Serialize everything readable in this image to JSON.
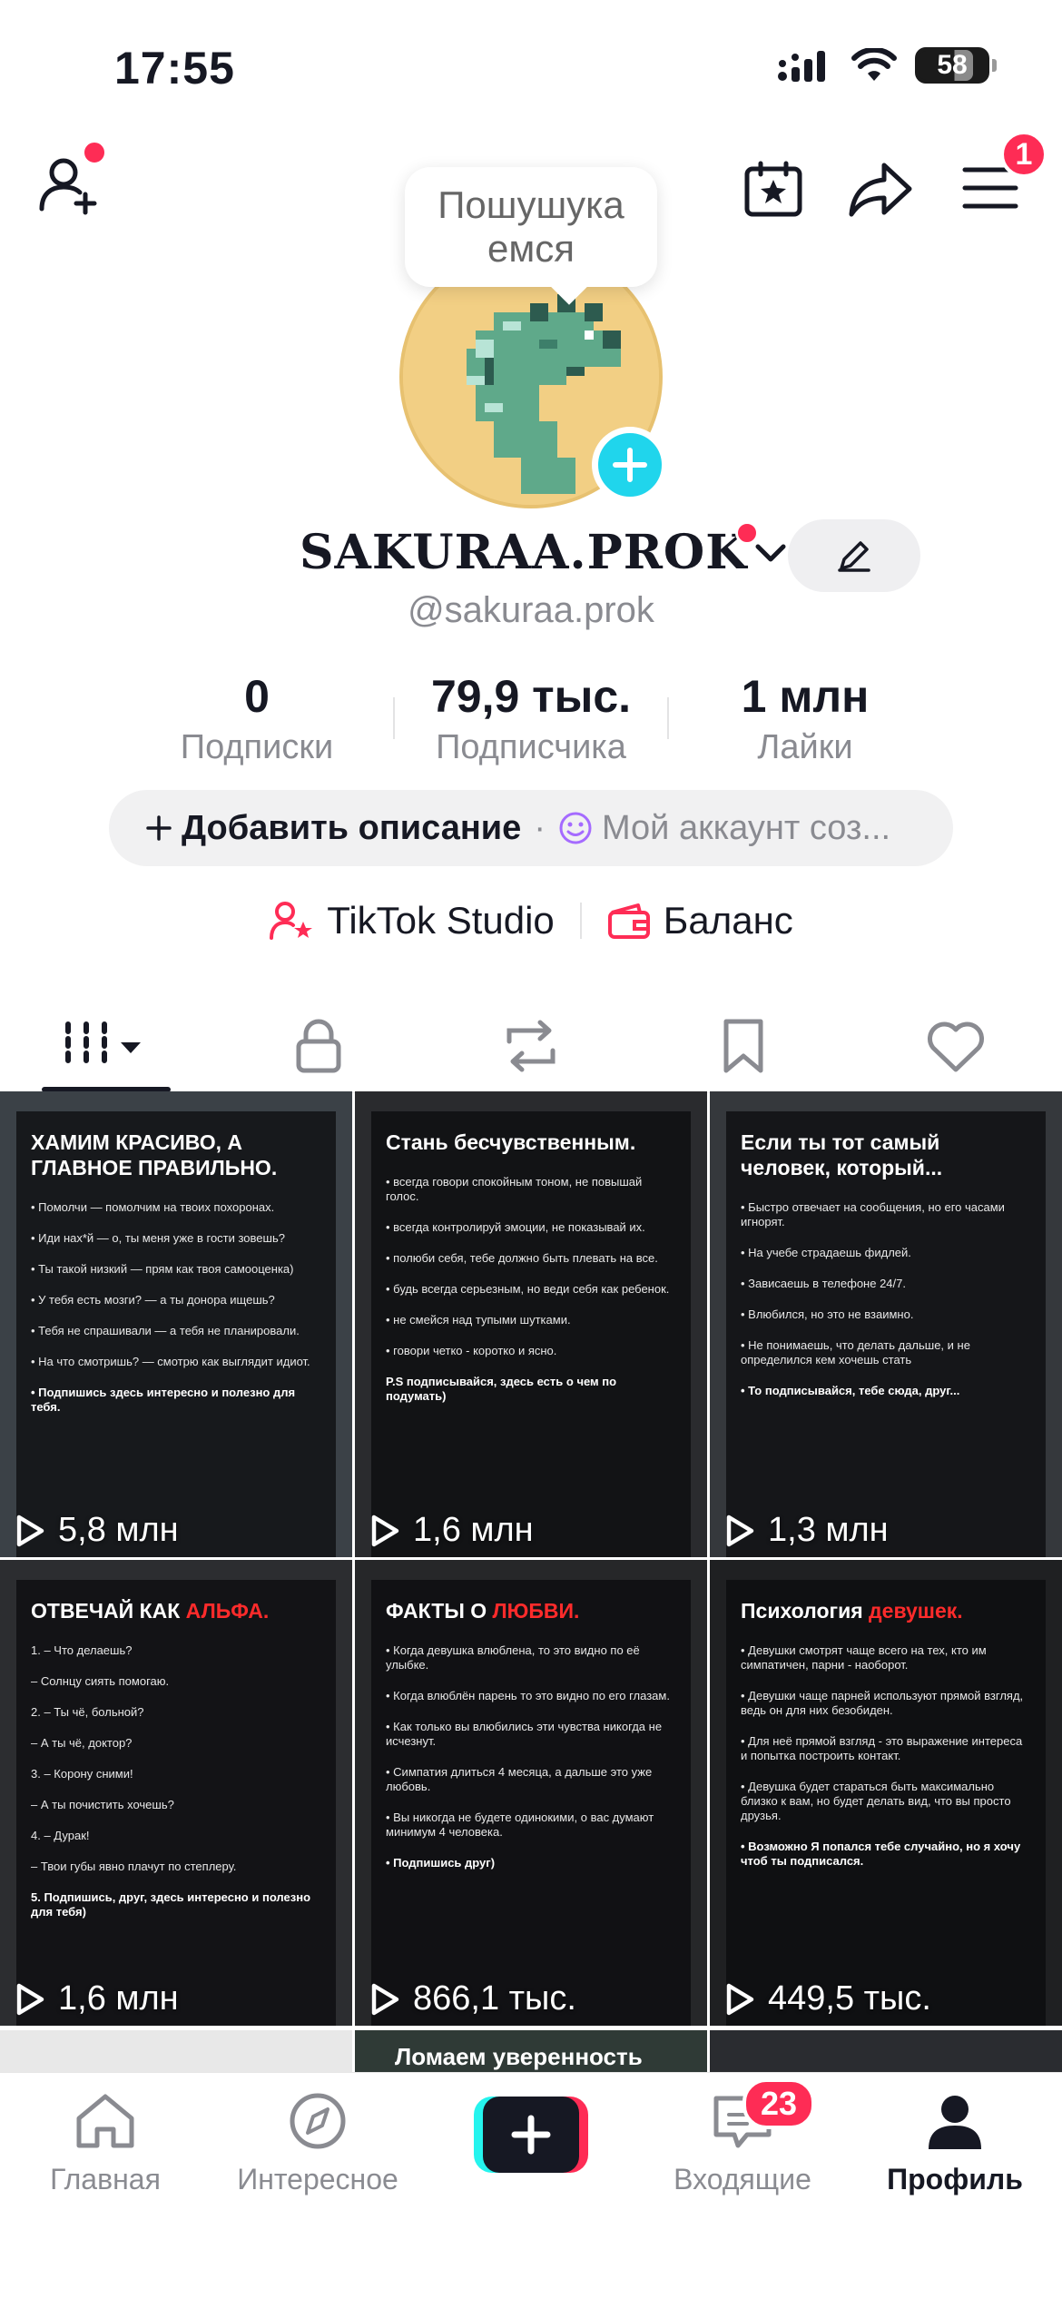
{
  "status_bar": {
    "time": "17:55",
    "battery": "58"
  },
  "top_nav": {
    "menu_badge": "1"
  },
  "profile": {
    "bubble_text": "Пошушука емся",
    "display_name": "SAKURAA.PROK",
    "handle": "@sakuraa.prok"
  },
  "stats": [
    {
      "value": "0",
      "label": "Подписки"
    },
    {
      "value": "79,9 тыс.",
      "label": "Подписчика"
    },
    {
      "value": "1 млн",
      "label": "Лайки"
    }
  ],
  "description": {
    "add_label": "Добавить описание",
    "separator": "·",
    "bio_preview": "Мой аккаунт соз..."
  },
  "links": {
    "studio": "TikTok Studio",
    "balance": "Баланс"
  },
  "tabs": [
    "videos",
    "private",
    "reposts",
    "saved",
    "liked"
  ],
  "videos": [
    {
      "views": "5,8 млн",
      "title": "ХАМИМ КРАСИВО, А ГЛАВНОЕ ПРАВИЛЬНО.",
      "title_red": "",
      "lines": [
        "• Помолчи — помолчим на твоих похоронах.",
        "• Иди нах*й — о, ты меня уже в гости зовешь?",
        "• Ты такой низкий — прям как твоя самооценка)",
        "• У тебя есть мозги? — а ты донора ищешь?",
        "• Тебя не спрашивали — а тебя не планировали.",
        "• На что смотришь? — смотрю как выглядит идиот.",
        "• Подпишись здесь интересно и полезно для тебя."
      ]
    },
    {
      "views": "1,6 млн",
      "title": "Стань бесчувственным.",
      "title_red": "",
      "lines": [
        "• всегда говори спокойным тоном, не повышай голос.",
        "• всегда контролируй эмоции, не показывай их.",
        "• полюби себя, тебе должно быть плевать на все.",
        "• будь всегда серьезным, но веди себя как ребенок.",
        "• не смейся над тупыми шутками.",
        "• говори четко - коротко и ясно.",
        "P.S подписывайся, здесь есть о чем по подумать)"
      ]
    },
    {
      "views": "1,3 млн",
      "title": "Если ты тот самый человек, который...",
      "title_red": "",
      "lines": [
        "• Быстро отвечает на сообщения, но его часами игнорят.",
        "• На учебе страдаешь фидлей.",
        "• Зависаешь в телефоне 24/7.",
        "• Влюбился, но это не взаимно.",
        "• Не понимаешь, что делать дальше, и не определился кем хочешь стать",
        "• То подписывайся, тебе сюда, друг..."
      ]
    },
    {
      "views": "1,6 млн",
      "title": "ОТВЕЧАЙ КАК ",
      "title_red": "АЛЬФА.",
      "lines": [
        "1. – Что делаешь?",
        "– Солнцу сиять помогаю.",
        "2. – Ты чё, больной?",
        "– А ты чё, доктор?",
        "3. – Корону сними!",
        "– А ты почистить хочешь?",
        "4. – Дурак!",
        "– Твои губы явно плачут по степлеру.",
        "5. Подпишись, друг, здесь интересно и полезно для тебя)"
      ]
    },
    {
      "views": "866,1 тыс.",
      "title": "ФАКТЫ О ",
      "title_red": "ЛЮБВИ.",
      "lines": [
        "• Когда девушка влюблена, то это видно по её улыбке.",
        "• Когда влюблён парень то это видно по его глазам.",
        "• Как только вы влюбились эти чувства никогда не исчезнут.",
        "• Симпатия длиться 4 месяца, а дальше это уже любовь.",
        "• Вы никогда не будете одинокими, о вас думают минимум 4 человека.",
        "• Подпишись друг)"
      ]
    },
    {
      "views": "449,5 тыс.",
      "title": "Психология ",
      "title_red": "девушек.",
      "lines": [
        "• Девушки смотрят чаще всего на тех, кто им симпатичен, парни - наоборот.",
        "• Девушки чаще парней используют прямой взгляд, ведь он для них безобиден.",
        "• Для неё прямой взгляд - это выражение интереса и попытка построить контакт.",
        "• Девушка будет стараться быть максимально близко к вам, но будет делать вид, что вы просто друзья.",
        "• Возможно Я попался тебе случайно, но я хочу чтоб ты подписался."
      ]
    }
  ],
  "partial_row_text": "Ломаем уверенность",
  "bottom_nav": {
    "home": "Главная",
    "discover": "Интересное",
    "inbox": "Входящие",
    "inbox_badge": "23",
    "profile": "Профиль"
  },
  "colors": {
    "accent_red": "#fe2c55",
    "accent_cyan": "#20d5ec",
    "text": "#161823",
    "muted": "#8a8b91"
  }
}
